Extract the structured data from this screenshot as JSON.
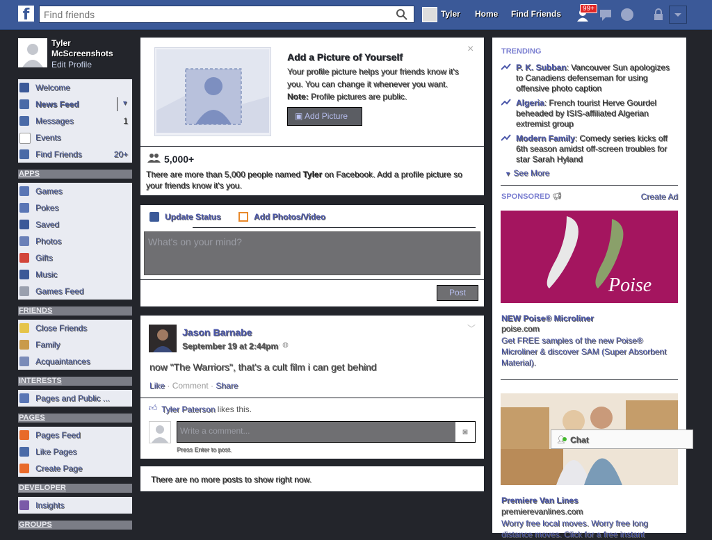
{
  "topbar": {
    "logo": "f",
    "search_placeholder": "Find friends",
    "user_name": "Tyler",
    "home": "Home",
    "find_friends": "Find Friends",
    "notif_badge": "99+"
  },
  "profile": {
    "name_line1": "Tyler",
    "name_line2": "McScreenshots",
    "edit": "Edit Profile"
  },
  "left_nav": {
    "main": [
      {
        "label": "Welcome",
        "count": ""
      },
      {
        "label": "News Feed",
        "count": ""
      },
      {
        "label": "Messages",
        "count": "1"
      },
      {
        "label": "Events",
        "count": ""
      },
      {
        "label": "Find Friends",
        "count": "20+"
      }
    ],
    "apps_header": "APPS",
    "apps": [
      "Games",
      "Pokes",
      "Saved",
      "Photos",
      "Gifts",
      "Music",
      "Games Feed"
    ],
    "friends_header": "FRIENDS",
    "friends": [
      "Close Friends",
      "Family",
      "Acquaintances"
    ],
    "interests_header": "INTERESTS",
    "interests": [
      "Pages and Public ..."
    ],
    "pages_header": "PAGES",
    "pages": [
      "Pages Feed",
      "Like Pages",
      "Create Page"
    ],
    "developer_header": "DEVELOPER",
    "developer": [
      "Insights"
    ],
    "groups_header": "GROUPS"
  },
  "profile_prompt": {
    "title": "Add a Picture of Yourself",
    "body": "Your profile picture helps your friends know it's you. You can change it whenever you want.",
    "note_label": "Note:",
    "note_text": " Profile pictures are public.",
    "button": "Add Picture",
    "close": "×",
    "count": "5,000+",
    "names_pre": "There are more than 5,000 people named ",
    "names_bold": "Tyler",
    "names_post": " on Facebook. Add a profile picture so your friends know it's you."
  },
  "composer": {
    "update_status": "Update Status",
    "add_photos": "Add Photos/Video",
    "placeholder": "What's on your mind?",
    "post": "Post"
  },
  "post": {
    "author": "Jason Barnabe",
    "time": "September 19 at 2:44pm",
    "text": "now \"The Warriors\", that's a cult film i can get behind",
    "like": "Like",
    "comment": "Comment",
    "share": "Share",
    "liker": "Tyler Paterson",
    "likes_suffix": " likes this.",
    "comment_placeholder": "Write a comment...",
    "enter_hint": "Press Enter to post."
  },
  "no_more": "There are no more posts to show right now.",
  "trending": {
    "header": "TRENDING",
    "items": [
      {
        "topic": "P. K. Subban",
        "text": ": Vancouver Sun apologizes to Canadiens defenseman for using offensive photo caption"
      },
      {
        "topic": "Algeria",
        "text": ": French tourist Herve Gourdel beheaded by ISIS-affiliated Algerian extremist group"
      },
      {
        "topic": "Modern Family",
        "text": ": Comedy series kicks off 6th season amidst off-screen troubles for star Sarah Hyland"
      }
    ],
    "see_more": "See More"
  },
  "sponsored": {
    "header": "SPONSORED",
    "create_ad": "Create Ad",
    "ads": [
      {
        "title": "NEW Poise® Microliner",
        "domain": "poise.com",
        "body": "Get FREE samples of the new Poise® Microliner & discover SAM (Super Absorbent Material).",
        "brand": "Poise"
      },
      {
        "title": "Premiere Van Lines",
        "domain": "premierevanlines.com",
        "body": "Worry free local moves. Worry free long distance moves. Click for a free instant"
      }
    ]
  },
  "chat": {
    "label": "Chat"
  },
  "colors": {
    "brand": "#3b5998",
    "link": "#4b57aa"
  }
}
